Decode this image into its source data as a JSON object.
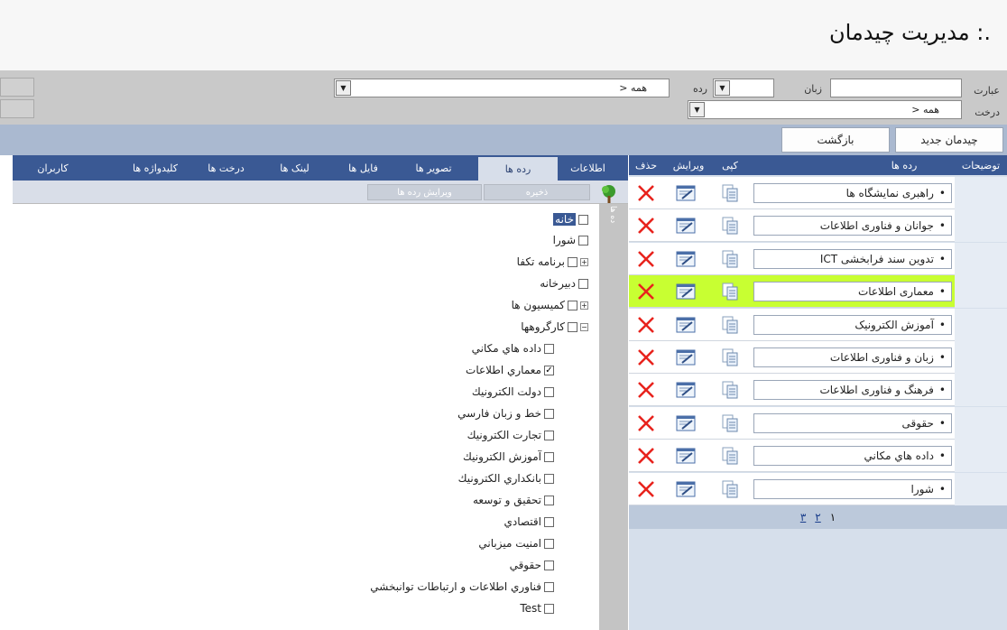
{
  "page": {
    "title": ".: مدیریت چیدمان"
  },
  "filter": {
    "phrase_label": "عبارت",
    "language_label": "زبان",
    "row_label": "رده",
    "row_value": "> همه",
    "tree_label": "درخت",
    "tree_value": "> همه"
  },
  "toolbar": {
    "new_label": "چیدمان جدید",
    "back_label": "بازگشت"
  },
  "tabs": [
    {
      "label": "اطلاعات"
    },
    {
      "label": "رده ها"
    },
    {
      "label": "تصویر ها"
    },
    {
      "label": "فایل ها"
    },
    {
      "label": "لینک ها"
    },
    {
      "label": "درخت ها"
    },
    {
      "label": "کلیدواژه ها"
    },
    {
      "label": "کاربران"
    }
  ],
  "tab_toolbar": {
    "save_label": "ذخیره",
    "edit_rows_label": "ویرایش رده ها"
  },
  "tree": [
    {
      "label": "خانه"
    },
    {
      "label": "شورا"
    },
    {
      "label": "برنامه تكفا"
    },
    {
      "label": "دبيرخانه"
    },
    {
      "label": "كميسيون ها"
    },
    {
      "label": "كارگروهها"
    },
    {
      "label": "داده هاي مكاني"
    },
    {
      "label": "معماري اطلاعات"
    },
    {
      "label": "دولت الكترونيك"
    },
    {
      "label": "خط و زبان فارسي"
    },
    {
      "label": "تجارت الكترونيك"
    },
    {
      "label": "آموزش الكترونيك"
    },
    {
      "label": "بانكداري الكترونيك"
    },
    {
      "label": "تحقيق و توسعه"
    },
    {
      "label": "اقتصادي"
    },
    {
      "label": "امنيت ميزباني"
    },
    {
      "label": "حقوقي"
    },
    {
      "label": "فناوري اطلاعات و ارتباطات توانبخشي"
    },
    {
      "label": "Test"
    }
  ],
  "grid": {
    "headers": {
      "description": "توضیحات",
      "rows": "رده ها",
      "copy": "کپی",
      "edit": "ویرایش",
      "delete": "حذف"
    },
    "rows": [
      {
        "name": "راهبری نمایشگاه ها"
      },
      {
        "name": "جوانان و فناوری اطلاعات"
      },
      {
        "name": "تدوین سند فرابخشی ICT"
      },
      {
        "name": "معماری اطلاعات"
      },
      {
        "name": "آموزش الکترونیک"
      },
      {
        "name": "زبان و فناوری اطلاعات"
      },
      {
        "name": "فرهنگ و فناوری اطلاعات"
      },
      {
        "name": "حقوقی"
      },
      {
        "name": "داده هاي مكاني"
      },
      {
        "name": "شورا"
      }
    ],
    "pages": [
      "١",
      "٢",
      "٣"
    ]
  },
  "colors": {
    "header_blue": "#3a5994",
    "highlight": "#c8ff32",
    "delete_red": "#e8231d"
  }
}
